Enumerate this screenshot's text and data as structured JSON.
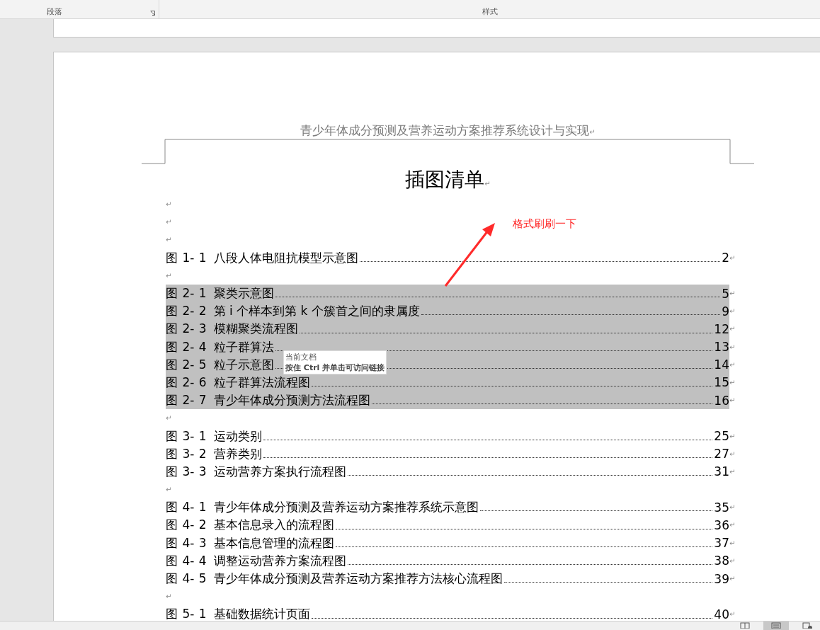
{
  "ribbon": {
    "groups": [
      {
        "label": "段落",
        "launcher": true
      },
      {
        "label": "样式"
      }
    ]
  },
  "document": {
    "header": "青少年体成分预测及营养运动方案推荐系统设计与实现",
    "header_mark": "↵",
    "title": "插图清单",
    "title_mark": "↵",
    "lines": [
      {
        "kind": "blank",
        "mark": "↵"
      },
      {
        "kind": "blank",
        "mark": "↵"
      },
      {
        "kind": "blank",
        "mark": "↵"
      },
      {
        "kind": "entry",
        "label": "图 1- 1",
        "title": "八段人体电阻抗模型示意图",
        "page": "2",
        "mark": "↵",
        "selected": false
      },
      {
        "kind": "blank",
        "mark": "↵"
      },
      {
        "kind": "entry",
        "label": "图 2- 1",
        "title": "聚类示意图",
        "page": "5",
        "mark": "↵",
        "selected": true
      },
      {
        "kind": "entry",
        "label": "图 2- 2",
        "title": "第 i 个样本到第 k 个簇首之间的隶属度",
        "page": "9",
        "mark": "↵",
        "selected": true
      },
      {
        "kind": "entry",
        "label": "图 2- 3",
        "title": "模糊聚类流程图",
        "page": "12",
        "mark": "↵",
        "selected": true
      },
      {
        "kind": "entry",
        "label": "图 2- 4",
        "title": "粒子群算法",
        "page": "13",
        "mark": "↵",
        "selected": true
      },
      {
        "kind": "entry",
        "label": "图 2- 5",
        "title": "粒子示意图",
        "page": "14",
        "mark": "↵",
        "selected": true
      },
      {
        "kind": "entry",
        "label": "图 2- 6",
        "title": "粒子群算法流程图",
        "page": "15",
        "mark": "↵",
        "selected": true
      },
      {
        "kind": "entry",
        "label": "图 2- 7",
        "title": "青少年体成分预测方法流程图",
        "page": "16",
        "mark": "↵",
        "selected": true
      },
      {
        "kind": "blank",
        "mark": "↵"
      },
      {
        "kind": "entry",
        "label": "图 3- 1",
        "title": "运动类别",
        "page": "25",
        "mark": "↵",
        "selected": false
      },
      {
        "kind": "entry",
        "label": "图 3- 2",
        "title": "营养类别",
        "page": "27",
        "mark": "↵",
        "selected": false
      },
      {
        "kind": "entry",
        "label": "图 3- 3",
        "title": "运动营养方案执行流程图",
        "page": "31",
        "mark": "↵",
        "selected": false
      },
      {
        "kind": "blank",
        "mark": "↵"
      },
      {
        "kind": "entry",
        "label": "图 4- 1",
        "title": "青少年体成分预测及营养运动方案推荐系统示意图",
        "page": "35",
        "mark": "↵",
        "selected": false
      },
      {
        "kind": "entry",
        "label": "图 4- 2",
        "title": "基本信息录入的流程图",
        "page": "36",
        "mark": "↵",
        "selected": false
      },
      {
        "kind": "entry",
        "label": "图 4- 3",
        "title": "基本信息管理的流程图",
        "page": "37",
        "mark": "↵",
        "selected": false
      },
      {
        "kind": "entry",
        "label": "图 4- 4",
        "title": "调整运动营养方案流程图",
        "page": "38",
        "mark": "↵",
        "selected": false
      },
      {
        "kind": "entry",
        "label": "图 4- 5",
        "title": "青少年体成分预测及营养运动方案推荐方法核心流程图",
        "page": "39",
        "mark": "↵",
        "selected": false
      },
      {
        "kind": "blank",
        "mark": "↵"
      },
      {
        "kind": "entry",
        "label": "图 5- 1",
        "title": "基础数据统计页面",
        "page": "40",
        "mark": "↵",
        "selected": false
      }
    ],
    "tooltip": {
      "title": "当前文档",
      "hint": "按住 Ctrl 并单击可访问链接"
    },
    "annotation": {
      "text": "格式刷刷一下"
    }
  },
  "status_bar": {
    "views": [
      {
        "kind": "read",
        "selected": false
      },
      {
        "kind": "print",
        "selected": true
      },
      {
        "kind": "web",
        "selected": false
      }
    ]
  }
}
